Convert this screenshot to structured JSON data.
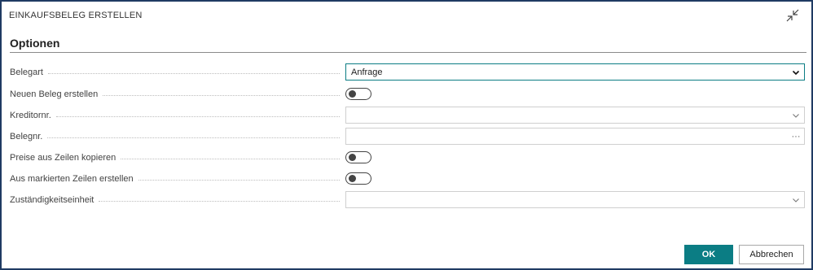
{
  "dialog": {
    "title": "EINKAUFSBELEG ERSTELLEN",
    "collapse_icon": "collapse-arrows-icon"
  },
  "section": {
    "title": "Optionen"
  },
  "fields": {
    "belegart": {
      "label": "Belegart",
      "value": "Anfrage",
      "icon": "chevron-down-icon"
    },
    "neuen_beleg": {
      "label": "Neuen Beleg erstellen",
      "on": false
    },
    "kreditornr": {
      "label": "Kreditornr.",
      "value": "",
      "icon": "chevron-down-icon"
    },
    "belegnr": {
      "label": "Belegnr.",
      "value": "",
      "icon": "ellipsis-icon",
      "trail": "···"
    },
    "preise": {
      "label": "Preise aus Zeilen kopieren",
      "on": false
    },
    "aus_markierten": {
      "label": "Aus markierten Zeilen erstellen",
      "on": false
    },
    "zustaendigkeit": {
      "label": "Zuständigkeitseinheit",
      "value": "",
      "icon": "chevron-down-icon"
    }
  },
  "buttons": {
    "ok": "OK",
    "cancel": "Abbrechen"
  },
  "colors": {
    "accent": "#0b7d84",
    "frame": "#1f3b63"
  }
}
